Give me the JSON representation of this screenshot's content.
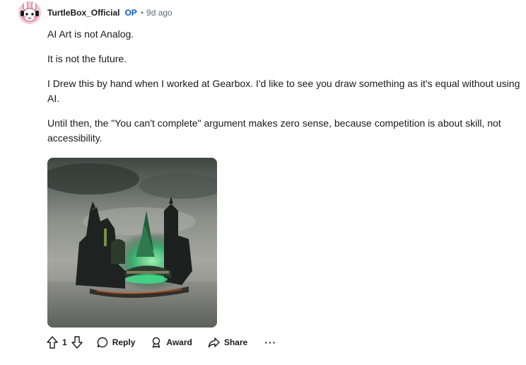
{
  "comment": {
    "username": "TurtleBox_Official",
    "op_badge": "OP",
    "separator": "•",
    "time": "9d ago",
    "avatar_icon": "avatar-bunny-icon",
    "paragraphs": [
      "AI Art is not Analog.",
      "It is not the future.",
      "I Drew this by hand when I worked at Gearbox. I'd like to see you draw something as it's equal without using AI.",
      "Until then, the \"You can't complete\" argument makes zero sense, because competition is about skill, not accessibility."
    ],
    "image_description_icon": "fantasy-ruins-artwork-image"
  },
  "actions": {
    "upvote_icon": "upvote-arrow-icon",
    "vote_count": "1",
    "downvote_icon": "downvote-arrow-icon",
    "reply_icon": "speech-bubble-icon",
    "reply_label": "Reply",
    "award_icon": "award-ribbon-icon",
    "award_label": "Award",
    "share_icon": "share-arrow-icon",
    "share_label": "Share",
    "more_label": "···"
  },
  "colors": {
    "op_badge": "#0a5cc7",
    "text": "#1a1a1b",
    "meta": "#576f76",
    "avatar_bg": "#f4c9d6"
  }
}
